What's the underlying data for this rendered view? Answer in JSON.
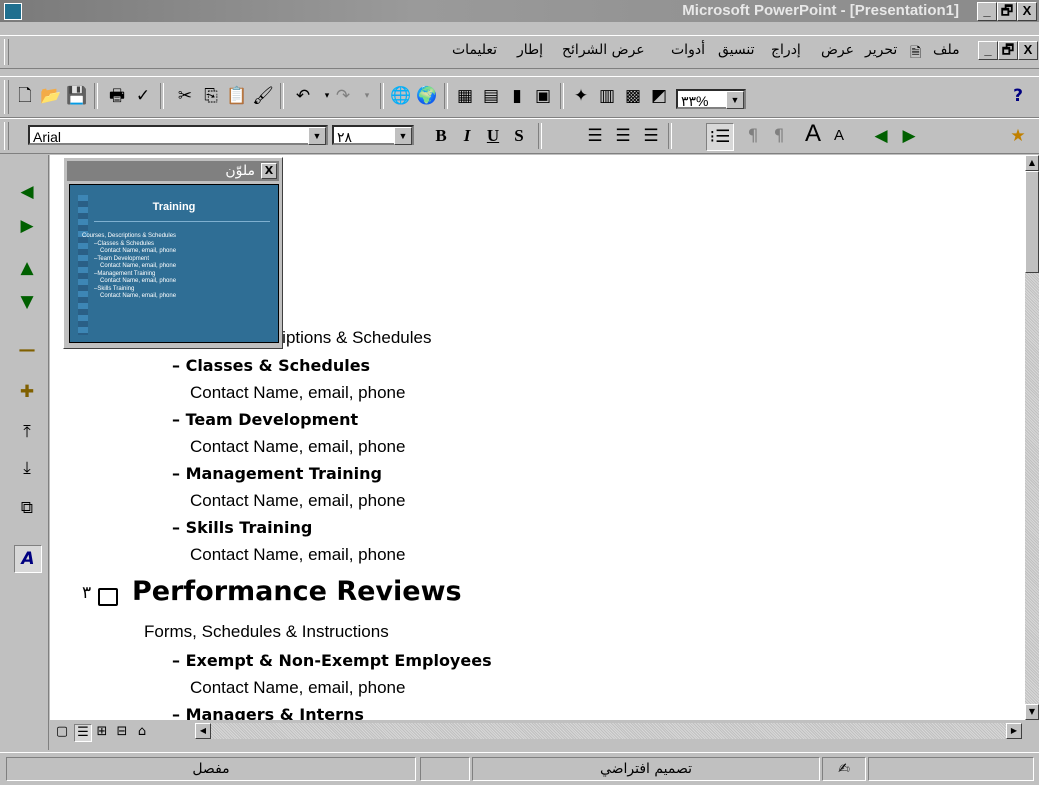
{
  "window": {
    "title": "Microsoft PowerPoint - [Presentation1]"
  },
  "window_controls": {
    "minimize": "_",
    "restore": "🗗",
    "close": "X"
  },
  "menu": {
    "items": [
      "ملف",
      "تحرير",
      "عرض",
      "إدراج",
      "تنسيق",
      "أدوات",
      "عرض الشرائح",
      "إطار",
      "تعليمات"
    ]
  },
  "toolbar": {
    "zoom": "٣٣%",
    "help_icon": "?"
  },
  "format_bar": {
    "font": "Arial",
    "size": "٢٨"
  },
  "preview": {
    "title": "ملوّن",
    "close": "X",
    "slide_title": "Training",
    "slide_lines": [
      "Courses, Descriptions & Schedules",
      "–Classes & Schedules",
      "Contact Name, email, phone",
      "–Team Development",
      "Contact Name, email, phone",
      "–Management Training",
      "Contact Name, email, phone",
      "–Skills Training",
      "Contact Name, email, phone"
    ]
  },
  "outline": {
    "partial_line": "criptions & Schedules",
    "items": [
      {
        "head": "– Classes & Schedules",
        "detail": "Contact Name, email, phone"
      },
      {
        "head": "– Team Development",
        "detail": "Contact Name, email, phone"
      },
      {
        "head": "– Management Training",
        "detail": "Contact Name, email, phone"
      },
      {
        "head": "– Skills Training",
        "detail": "Contact Name, email, phone"
      }
    ],
    "slide3_number": "٣",
    "slide3_title": "Performance Reviews",
    "slide3_sub": "Forms, Schedules & Instructions",
    "slide3_items": [
      {
        "head": "– Exempt & Non-Exempt Employees",
        "detail": "Contact Name, email, phone"
      },
      {
        "head": "– Managers & Interns",
        "detail": ""
      }
    ]
  },
  "status": {
    "view": "مفصل",
    "design": "تصميم افتراضي"
  }
}
